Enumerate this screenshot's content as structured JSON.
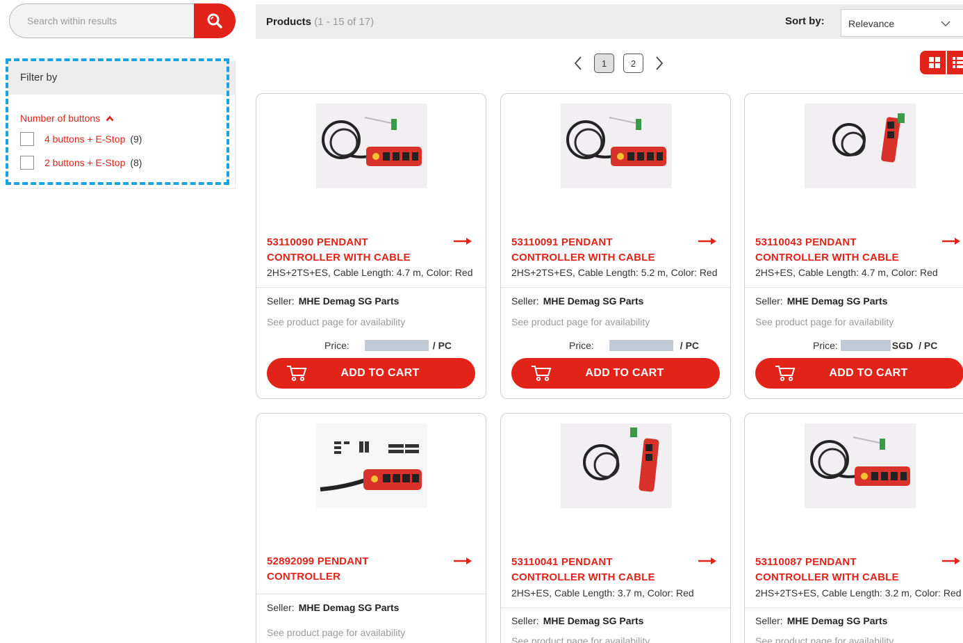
{
  "search": {
    "placeholder": "Search within results"
  },
  "filter": {
    "title": "Filter by",
    "facet_title": "Number of buttons",
    "options": [
      {
        "label": "4 buttons + E-Stop",
        "count": "(9)"
      },
      {
        "label": "2 buttons + E-Stop",
        "count": "(8)"
      }
    ]
  },
  "header": {
    "title": "Products",
    "range": "(1 - 15 of 17)",
    "sort_label": "Sort by:",
    "sort_value": "Relevance"
  },
  "pagination": {
    "pages": [
      "1",
      "2"
    ],
    "active": "1"
  },
  "common": {
    "seller_label": "Seller:",
    "availability": "See product page for availability",
    "price_label": "Price:",
    "cart_label": "ADD TO CART"
  },
  "products": [
    {
      "name_line1": "53110090 PENDANT",
      "name_line2": "CONTROLLER WITH CABLE",
      "spec": "2HS+2TS+ES, Cable Length: 4.7 m, Color: Red",
      "seller": "MHE Demag SG Parts",
      "currency": "",
      "unit": "/ PC"
    },
    {
      "name_line1": "53110091 PENDANT",
      "name_line2": "CONTROLLER WITH CABLE",
      "spec": "2HS+2TS+ES, Cable Length: 5.2 m, Color: Red",
      "seller": "MHE Demag SG Parts",
      "currency": "",
      "unit": "/ PC"
    },
    {
      "name_line1": "53110043 PENDANT",
      "name_line2": "CONTROLLER WITH CABLE",
      "spec": "2HS+ES, Cable Length: 4.7 m, Color: Red",
      "seller": "MHE Demag SG Parts",
      "currency": "SGD",
      "unit": "/ PC"
    },
    {
      "name_line1": "52892099 PENDANT",
      "name_line2": "CONTROLLER",
      "spec": "",
      "seller": "MHE Demag SG Parts",
      "currency": "",
      "unit": ""
    },
    {
      "name_line1": "53110041 PENDANT",
      "name_line2": "CONTROLLER WITH CABLE",
      "spec": "2HS+ES, Cable Length: 3.7 m, Color: Red",
      "seller": "MHE Demag SG Parts",
      "currency": "",
      "unit": ""
    },
    {
      "name_line1": "53110087 PENDANT",
      "name_line2": "CONTROLLER WITH CABLE",
      "spec": "2HS+2TS+ES, Cable Length: 3.2 m, Color: Red",
      "seller": "MHE Demag SG Parts",
      "currency": "",
      "unit": ""
    }
  ],
  "colors": {
    "accent": "#e2231a",
    "highlight": "#1aa3e0"
  }
}
